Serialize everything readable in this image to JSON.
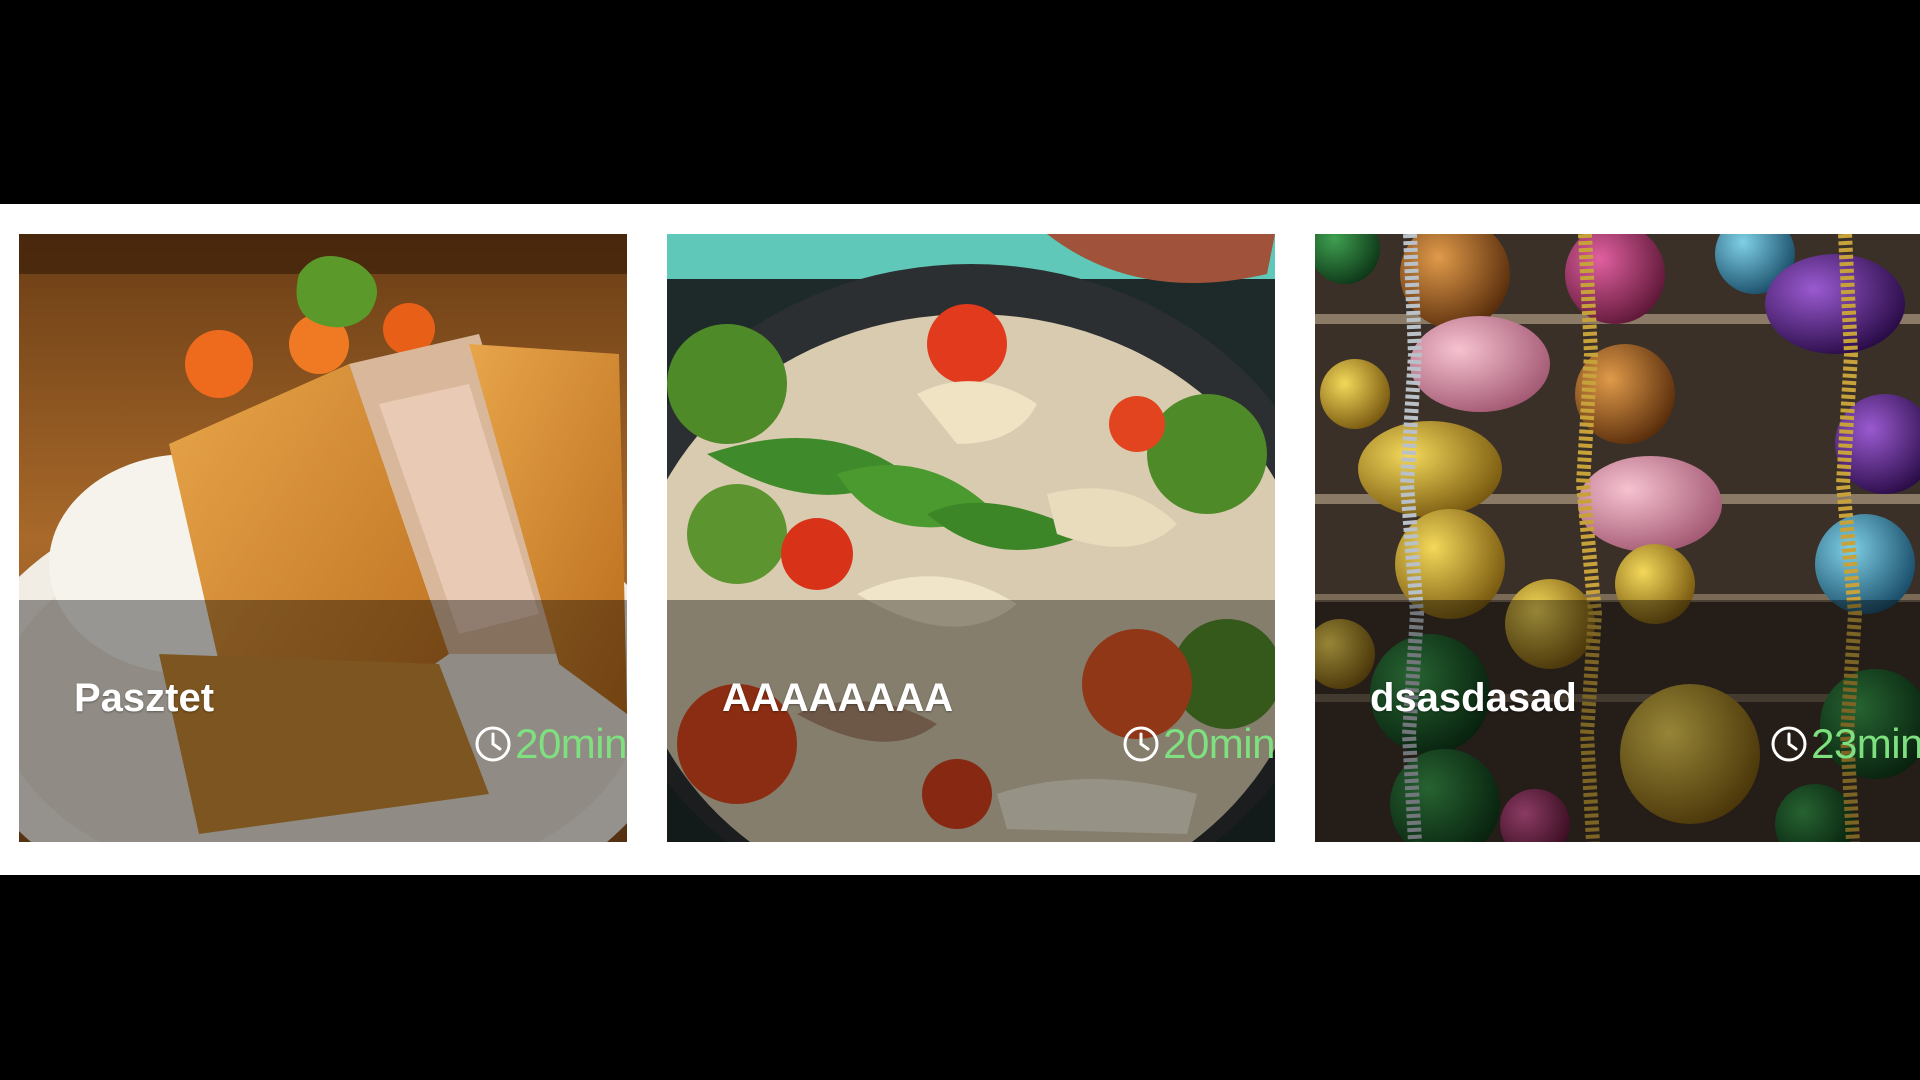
{
  "accent_time_color": "#7fe07f",
  "cards": [
    {
      "title": "Pasztet",
      "time": "20min",
      "image": "breaded-cutlet-plate-photo"
    },
    {
      "title": "AAAAAAAA",
      "time": "20min",
      "image": "pasta-vegetable-pan-photo"
    },
    {
      "title": "dsasdasad",
      "time": "23min",
      "image": "christmas-baubles-tinsel-photo"
    }
  ]
}
